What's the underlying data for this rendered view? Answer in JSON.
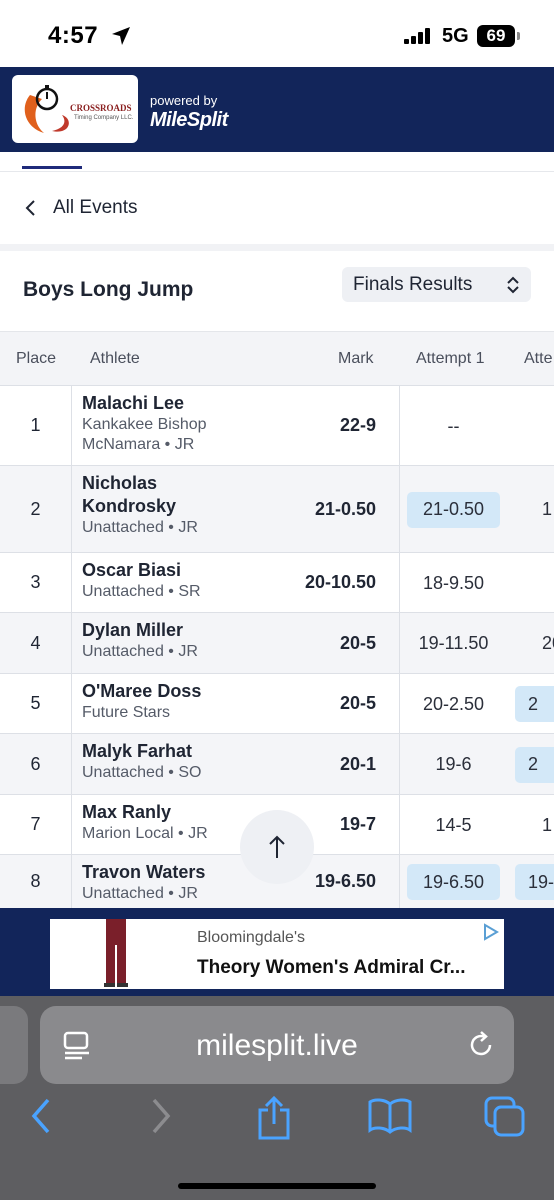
{
  "status_bar": {
    "time": "4:57",
    "network": "5G",
    "battery": "69"
  },
  "header": {
    "logo_text": "CROSSROADS",
    "logo_sub": "Timing Company LLC.",
    "powered_by": "powered by",
    "brand": "MileSplit"
  },
  "nav": {
    "back_label": "All Events"
  },
  "event": {
    "title": "Boys Long Jump",
    "round_select": "Finals Results"
  },
  "table": {
    "headers": {
      "place": "Place",
      "athlete": "Athlete",
      "mark": "Mark",
      "attempt1": "Attempt 1",
      "attempt2": "Atte"
    },
    "rows": [
      {
        "place": "1",
        "name": "Malachi Lee",
        "team": "Kankakee Bishop McNamara • JR",
        "mark": "22-9",
        "attempt1": "--",
        "attempt1_highlight": false,
        "attempt2": "",
        "attempt2_highlight": false
      },
      {
        "place": "2",
        "name": "Nicholas Kondrosky",
        "team": "Unattached • JR",
        "mark": "21-0.50",
        "attempt1": "21-0.50",
        "attempt1_highlight": true,
        "attempt2": "1",
        "attempt2_highlight": false
      },
      {
        "place": "3",
        "name": "Oscar Biasi",
        "team": "Unattached • SR",
        "mark": "20-10.50",
        "attempt1": "18-9.50",
        "attempt1_highlight": false,
        "attempt2": "",
        "attempt2_highlight": false
      },
      {
        "place": "4",
        "name": "Dylan Miller",
        "team": "Unattached • JR",
        "mark": "20-5",
        "attempt1": "19-11.50",
        "attempt1_highlight": false,
        "attempt2": "20-",
        "attempt2_highlight": false
      },
      {
        "place": "5",
        "name": "O'Maree Doss",
        "team": "Future Stars",
        "mark": "20-5",
        "attempt1": "20-2.50",
        "attempt1_highlight": false,
        "attempt2": "2",
        "attempt2_highlight": true
      },
      {
        "place": "6",
        "name": "Malyk Farhat",
        "team": "Unattached • SO",
        "mark": "20-1",
        "attempt1": "19-6",
        "attempt1_highlight": false,
        "attempt2": "2",
        "attempt2_highlight": true
      },
      {
        "place": "7",
        "name": "Max Ranly",
        "team": "Marion Local • JR",
        "mark": "19-7",
        "attempt1": "14-5",
        "attempt1_highlight": false,
        "attempt2": "1",
        "attempt2_highlight": false
      },
      {
        "place": "8",
        "name": "Travon Waters",
        "team": "Unattached • JR",
        "mark": "19-6.50",
        "attempt1": "19-6.50",
        "attempt1_highlight": true,
        "attempt2": "19-",
        "attempt2_highlight": true
      }
    ]
  },
  "ad": {
    "brand": "Bloomingdale's",
    "product": "Theory Women's Admiral Cr..."
  },
  "browser": {
    "url": "milesplit.live"
  },
  "colors": {
    "navy": "#12255a",
    "highlight": "#d3e8f8",
    "accent": "#1f2a7a"
  }
}
